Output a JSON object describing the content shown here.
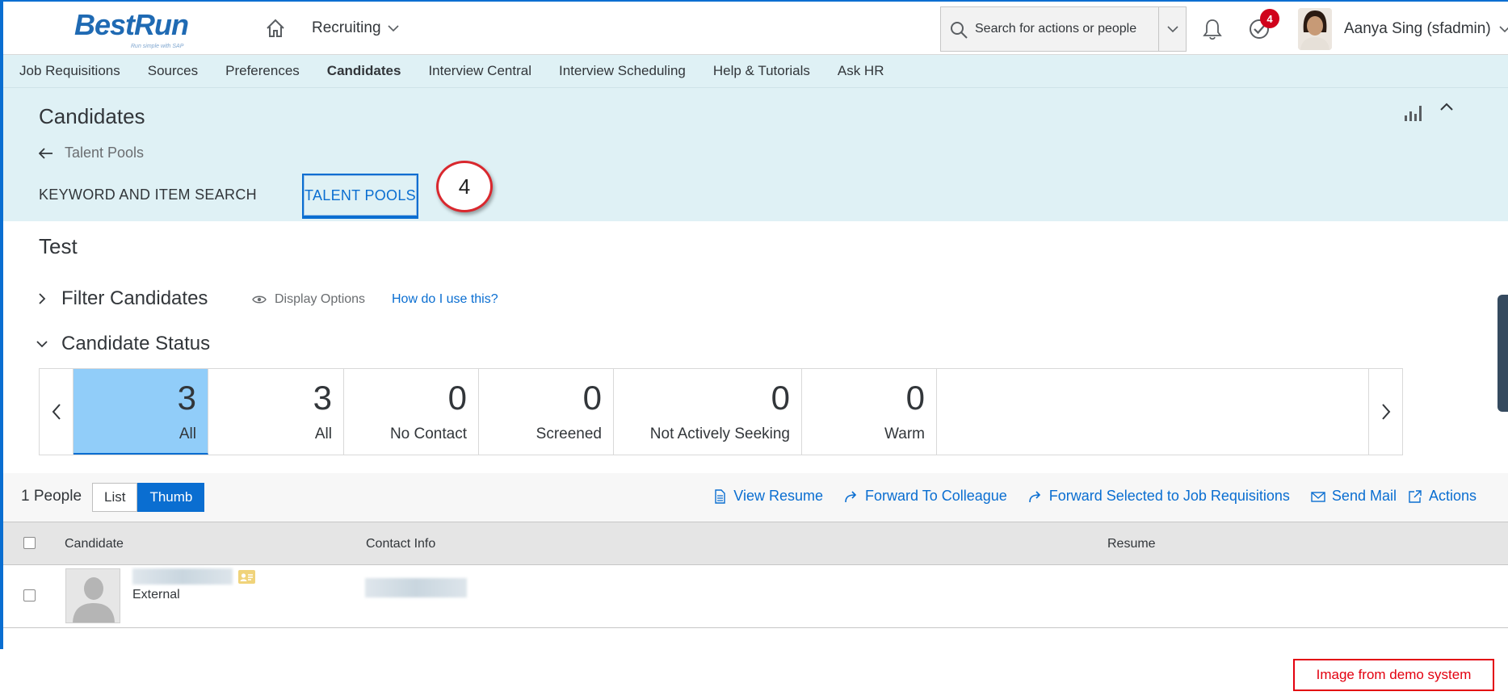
{
  "header": {
    "logo_text": "BestRun",
    "logo_tagline": "Run simple with SAP",
    "module_menu": "Recruiting",
    "search_placeholder": "Search for actions or people",
    "notifications_badge": "4",
    "user_name": "Aanya Sing (sfadmin)"
  },
  "nav": {
    "items": [
      {
        "label": "Job Requisitions"
      },
      {
        "label": "Sources"
      },
      {
        "label": "Preferences"
      },
      {
        "label": "Candidates",
        "active": true
      },
      {
        "label": "Interview Central"
      },
      {
        "label": "Interview Scheduling"
      },
      {
        "label": "Help & Tutorials"
      },
      {
        "label": "Ask HR"
      }
    ]
  },
  "page": {
    "title": "Candidates",
    "back_label": "Talent Pools",
    "tabs": {
      "keyword": "KEYWORD AND ITEM SEARCH",
      "talent_pools": "TALENT POOLS"
    },
    "step_marker": "4"
  },
  "pool": {
    "name": "Test",
    "filter_label": "Filter Candidates",
    "display_options": "Display Options",
    "help_link": "How do I use this?",
    "status_label": "Candidate Status"
  },
  "status_tiles": [
    {
      "count": "3",
      "label": "All",
      "selected": true
    },
    {
      "count": "3",
      "label": "All"
    },
    {
      "count": "0",
      "label": "No Contact"
    },
    {
      "count": "0",
      "label": "Screened"
    },
    {
      "count": "0",
      "label": "Not Actively Seeking"
    },
    {
      "count": "0",
      "label": "Warm"
    }
  ],
  "toolbar": {
    "people_count": "1 People",
    "view_list": "List",
    "view_thumb": "Thumb",
    "actions": {
      "view_resume": "View Resume",
      "forward_colleague": "Forward To Colleague",
      "forward_requisitions": "Forward Selected to Job Requisitions",
      "send_mail": "Send Mail",
      "actions": "Actions"
    }
  },
  "table": {
    "columns": {
      "candidate": "Candidate",
      "contact": "Contact Info",
      "resume": "Resume"
    },
    "rows": [
      {
        "type": "External"
      }
    ]
  },
  "watermark": "Image from demo system",
  "colors": {
    "accent": "#0a6ed1",
    "band_bg": "#dff1f5",
    "selected_tile": "#91cdf9",
    "badge": "#d0021b"
  }
}
